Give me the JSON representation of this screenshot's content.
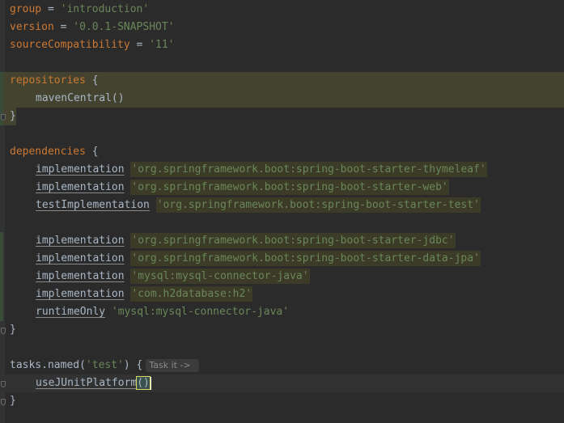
{
  "code": {
    "group_key": "group",
    "group_val": "'introduction'",
    "version_key": "version",
    "version_val": "'0.0.1-SNAPSHOT'",
    "compat_key": "sourceCompatibility",
    "compat_val": "'11'",
    "repositories": "repositories",
    "maven": "mavenCentral()",
    "dependencies": "dependencies",
    "deps": [
      {
        "cfg": "implementation",
        "val": "'org.springframework.boot:spring-boot-starter-thymeleaf'"
      },
      {
        "cfg": "implementation",
        "val": "'org.springframework.boot:spring-boot-starter-web'"
      },
      {
        "cfg": "testImplementation",
        "val": "'org.springframework.boot:spring-boot-starter-test'"
      },
      {
        "cfg": "implementation",
        "val": "'org.springframework.boot:spring-boot-starter-jdbc'"
      },
      {
        "cfg": "implementation",
        "val": "'org.springframework.boot:spring-boot-starter-data-jpa'"
      },
      {
        "cfg": "implementation",
        "val": "'mysql:mysql-connector-java'"
      },
      {
        "cfg": "implementation",
        "val": "'com.h2database:h2'"
      },
      {
        "cfg": "runtimeOnly",
        "val": "'mysql:mysql-connector-java'"
      }
    ],
    "tasks_prefix": "tasks.named(",
    "tasks_arg": "'test'",
    "tasks_suffix": ") {",
    "inlay_hint": "Task it ->",
    "junit_name": "useJUnitPlatform",
    "junit_parens": "()",
    "open_brace": "{",
    "close_brace": "}",
    "equals": " = "
  }
}
